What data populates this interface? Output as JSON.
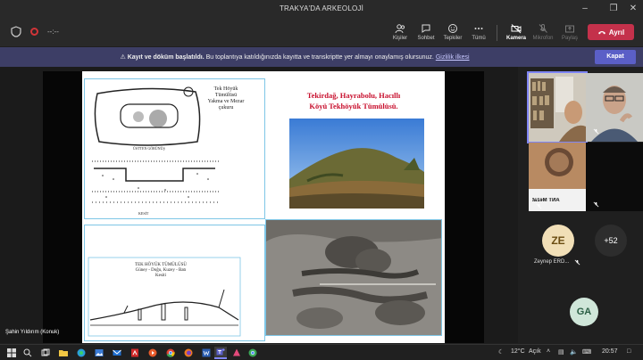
{
  "window": {
    "title": "TRAKYA'DA ARKEOLOJİ",
    "minimize_icon": "minimize-icon",
    "restore_icon": "restore-icon",
    "close_icon": "close-icon"
  },
  "toolbar": {
    "timer": "--:--",
    "buttons": [
      {
        "label": "Kişiler",
        "icon": "people-icon"
      },
      {
        "label": "Sohbet",
        "icon": "chat-icon"
      },
      {
        "label": "Tepkiler",
        "icon": "reactions-icon"
      },
      {
        "label": "Tümü",
        "icon": "more-icon"
      },
      {
        "label": "Kamera",
        "icon": "camera-icon"
      },
      {
        "label": "Mikrofon",
        "icon": "mic-icon"
      },
      {
        "label": "Paylaş",
        "icon": "share-icon"
      }
    ],
    "leave_label": "Ayrıl"
  },
  "banner": {
    "bold": "Kayıt ve döküm başlatıldı.",
    "text": "Bu toplantıya katıldığınızda kayıtta ve transkriptte yer almayı onaylamış olursunuz.",
    "link": "Gizlilik ilkesi",
    "close_label": "Kapat"
  },
  "slide": {
    "title_line1": "Tekirdağ, Hayrabolu, Hacıllı",
    "title_line2": "Köyü Tekhöyük Tümülüsü.",
    "drawing1": {
      "title1": "Tek Höyük",
      "title2": "Tümülüsü",
      "title3": "Yakma ve Mezar",
      "title4": "çukuru",
      "label_top": "ÜSTTEN GÖRÜNÜŞ",
      "label_side": "KESİT"
    },
    "drawing2": {
      "title1": "TEK HÖYÜK TÜMÜLÜSÜ",
      "title2": "Güney - Doğu, Kuzey - Batı",
      "title3": "Kesiti"
    }
  },
  "presenter_caption": "Şahin Yıldırım (Konuk)",
  "participants": {
    "tile3_text": "ANT Mezat",
    "zeynep_initials": "ZE",
    "zeynep_name": "Zeynep ERD...",
    "overflow_count": "+52",
    "ga_initials": "GA"
  },
  "taskbar": {
    "weather": "12°C",
    "weather_desc": "Açık",
    "time": "20:57"
  }
}
